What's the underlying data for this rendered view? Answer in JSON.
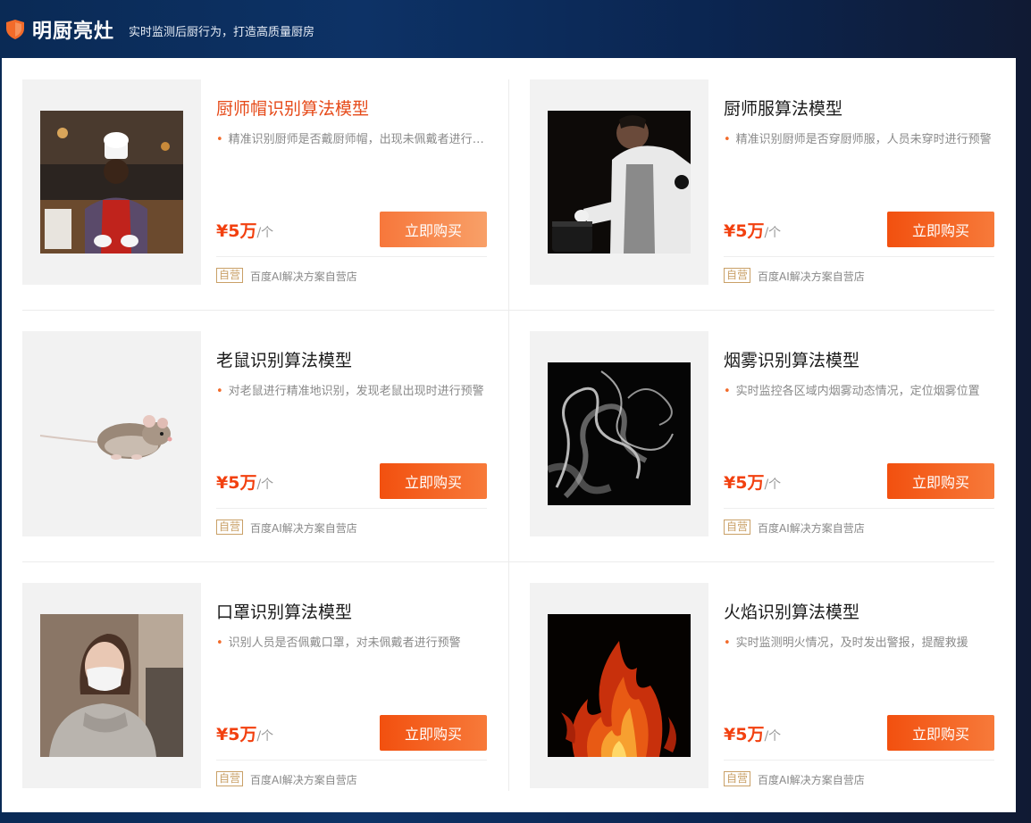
{
  "header": {
    "title": "明厨亮灶",
    "subtitle": "实时监测后厨行为，打造高质量厨房",
    "icon": "shield-icon",
    "accent": "#f26b2a"
  },
  "products": [
    {
      "title": "厨师帽识别算法模型",
      "desc": "精准识别厨师是否戴厨师帽，出现未佩戴者进行预警",
      "price": "¥5万",
      "unit": "/个",
      "buy_label": "立即购买",
      "tag": "自营",
      "store": "百度AI解决方案自营店",
      "image": "chef-hat-photo"
    },
    {
      "title": "厨师服算法模型",
      "desc": "精准识别厨师是否穿厨师服，人员未穿时进行预警",
      "price": "¥5万",
      "unit": "/个",
      "buy_label": "立即购买",
      "tag": "自营",
      "store": "百度AI解决方案自营店",
      "image": "chef-uniform-photo"
    },
    {
      "title": "老鼠识别算法模型",
      "desc": "对老鼠进行精准地识别，发现老鼠出现时进行预警",
      "price": "¥5万",
      "unit": "/个",
      "buy_label": "立即购买",
      "tag": "自营",
      "store": "百度AI解决方案自营店",
      "image": "rat-photo"
    },
    {
      "title": "烟雾识别算法模型",
      "desc": "实时监控各区域内烟雾动态情况，定位烟雾位置",
      "price": "¥5万",
      "unit": "/个",
      "buy_label": "立即购买",
      "tag": "自营",
      "store": "百度AI解决方案自营店",
      "image": "smoke-photo"
    },
    {
      "title": "口罩识别算法模型",
      "desc": "识别人员是否佩戴口罩，对未佩戴者进行预警",
      "price": "¥5万",
      "unit": "/个",
      "buy_label": "立即购买",
      "tag": "自营",
      "store": "百度AI解决方案自营店",
      "image": "mask-photo"
    },
    {
      "title": "火焰识别算法模型",
      "desc": "实时监测明火情况，及时发出警报，提醒救援",
      "price": "¥5万",
      "unit": "/个",
      "buy_label": "立即购买",
      "tag": "自营",
      "store": "百度AI解决方案自营店",
      "image": "fire-photo"
    }
  ]
}
